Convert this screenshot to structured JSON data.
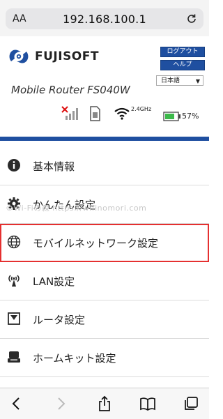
{
  "browser": {
    "aa_label": "AA",
    "url": "192.168.100.1"
  },
  "header": {
    "brand": "FUJISOFT",
    "logout_label": "ログアウト",
    "help_label": "ヘルプ",
    "language": "日本語",
    "model": "Mobile Router FS040W",
    "wifi_band": "2.4GHz",
    "battery": "57%"
  },
  "menu": {
    "items": [
      {
        "label": "基本情報"
      },
      {
        "label": "かんたん設定"
      },
      {
        "label": "モバイルネットワーク設定"
      },
      {
        "label": "LAN設定"
      },
      {
        "label": "ルータ設定"
      },
      {
        "label": "ホームキット設定"
      }
    ]
  },
  "watermark": "©Wi-Fiの森 https://wifinomori.com",
  "colors": {
    "brand_blue": "#1f4fa0",
    "highlight_red": "#e53030",
    "battery_green": "#3cb94a"
  }
}
